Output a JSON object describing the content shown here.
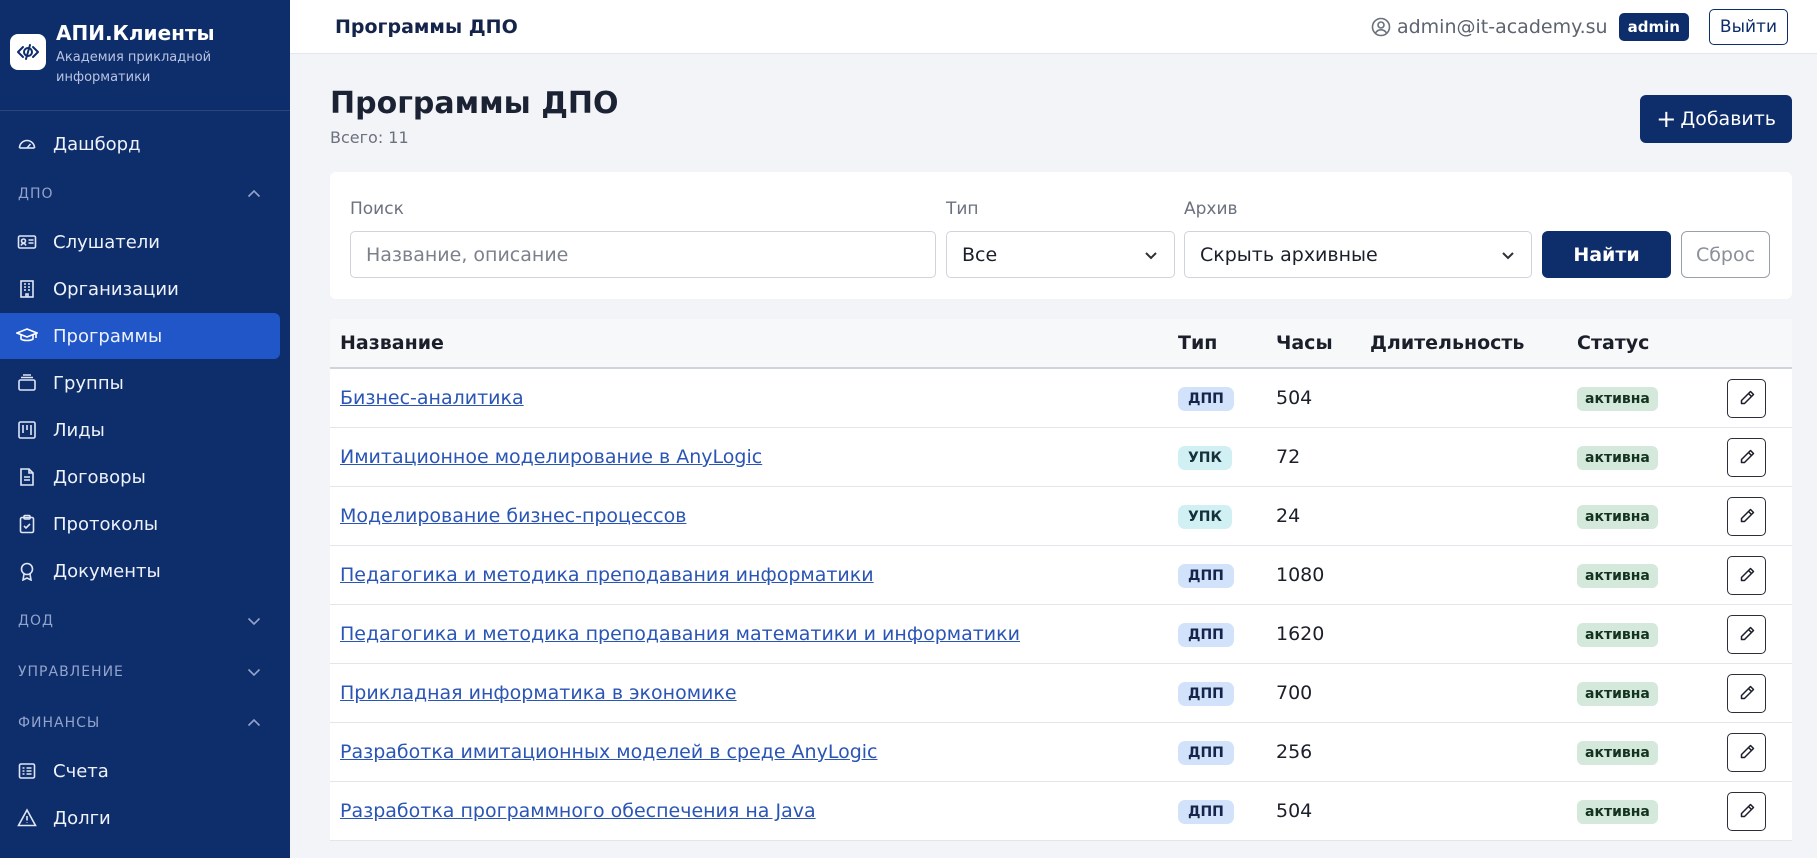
{
  "brand": {
    "title": "АПИ.Клиенты",
    "subtitle": "Академия прикладной информатики"
  },
  "sidebar": {
    "items": [
      {
        "kind": "item",
        "label": "Дашборд",
        "icon": "dashboard-icon"
      },
      {
        "kind": "section",
        "label": "ДПО",
        "expanded": true
      },
      {
        "kind": "item",
        "label": "Слушатели",
        "icon": "id-card-icon"
      },
      {
        "kind": "item",
        "label": "Организации",
        "icon": "building-icon"
      },
      {
        "kind": "item",
        "label": "Программы",
        "icon": "graduation-cap-icon",
        "active": true
      },
      {
        "kind": "item",
        "label": "Группы",
        "icon": "stack-icon"
      },
      {
        "kind": "item",
        "label": "Лиды",
        "icon": "kanban-icon"
      },
      {
        "kind": "item",
        "label": "Договоры",
        "icon": "document-icon"
      },
      {
        "kind": "item",
        "label": "Протоколы",
        "icon": "clipboard-icon"
      },
      {
        "kind": "item",
        "label": "Документы",
        "icon": "award-icon"
      },
      {
        "kind": "section",
        "label": "ДОД",
        "expanded": false
      },
      {
        "kind": "section",
        "label": "УПРАВЛЕНИЕ",
        "expanded": false
      },
      {
        "kind": "section",
        "label": "ФИНАНСЫ",
        "expanded": true
      },
      {
        "kind": "item",
        "label": "Счета",
        "icon": "invoice-icon"
      },
      {
        "kind": "item",
        "label": "Долги",
        "icon": "warning-icon"
      }
    ]
  },
  "topbar": {
    "title": "Программы ДПО",
    "user_email": "admin@it-academy.su",
    "role": "admin",
    "logout_label": "Выйти"
  },
  "page": {
    "title": "Программы ДПО",
    "count": "Всего: 11",
    "add_label": "Добавить"
  },
  "filters": {
    "search_label": "Поиск",
    "search_placeholder": "Название, описание",
    "type_label": "Тип",
    "type_value": "Все",
    "archive_label": "Архив",
    "archive_value": "Скрыть архивные",
    "find_label": "Найти",
    "reset_label": "Сброс"
  },
  "table": {
    "headers": {
      "name": "Название",
      "type": "Тип",
      "hours": "Часы",
      "duration": "Длительность",
      "status": "Статус"
    },
    "rows": [
      {
        "name": "Бизнес-аналитика",
        "type": "ДПП",
        "hours": "504",
        "duration": "",
        "status": "активна"
      },
      {
        "name": "Имитационное моделирование в AnyLogic",
        "type": "УПК",
        "hours": "72",
        "duration": "",
        "status": "активна"
      },
      {
        "name": "Моделирование бизнес-процессов",
        "type": "УПК",
        "hours": "24",
        "duration": "",
        "status": "активна"
      },
      {
        "name": "Педагогика и методика преподавания информатики",
        "type": "ДПП",
        "hours": "1080",
        "duration": "",
        "status": "активна"
      },
      {
        "name": "Педагогика и методика преподавания математики и информатики",
        "type": "ДПП",
        "hours": "1620",
        "duration": "",
        "status": "активна"
      },
      {
        "name": "Прикладная информатика в экономике",
        "type": "ДПП",
        "hours": "700",
        "duration": "",
        "status": "активна"
      },
      {
        "name": "Разработка имитационных моделей в среде AnyLogic",
        "type": "ДПП",
        "hours": "256",
        "duration": "",
        "status": "активна"
      },
      {
        "name": "Разработка программного обеспечения на Java",
        "type": "ДПП",
        "hours": "504",
        "duration": "",
        "status": "активна"
      }
    ]
  },
  "colors": {
    "sidebar_bg": "#0e2d6b",
    "active_item": "#2156c9",
    "primary": "#0e2d6b",
    "link": "#2a55b5",
    "badge_dpp": "#d2e2fa",
    "badge_upk": "#d1f0f4",
    "badge_status": "#d4e8dc"
  }
}
